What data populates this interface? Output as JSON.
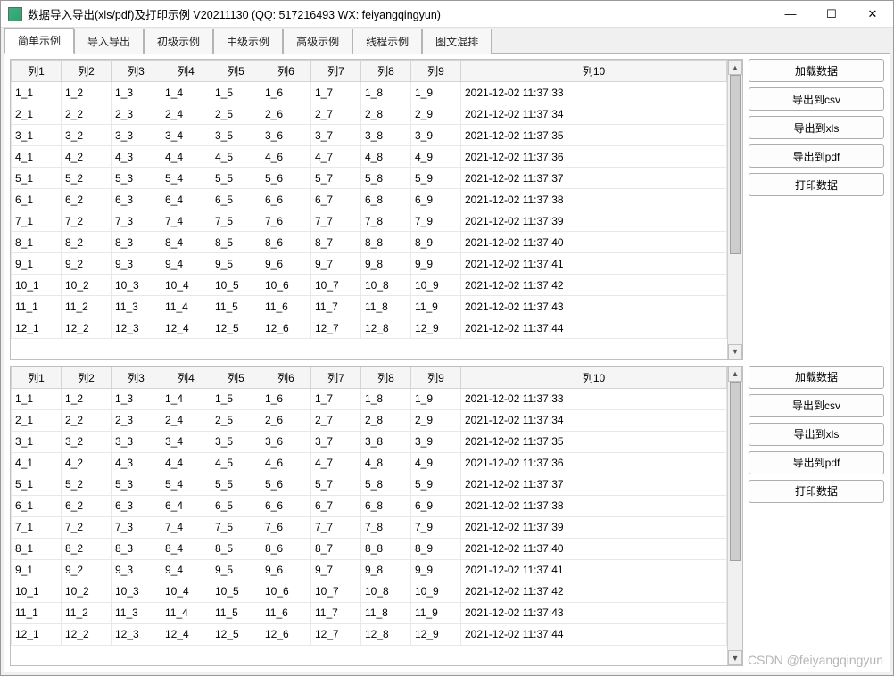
{
  "window": {
    "title": "数据导入导出(xls/pdf)及打印示例 V20211130 (QQ: 517216493 WX: feiyangqingyun)"
  },
  "tabs": [
    {
      "label": "简单示例",
      "active": true
    },
    {
      "label": "导入导出",
      "active": false
    },
    {
      "label": "初级示例",
      "active": false
    },
    {
      "label": "中级示例",
      "active": false
    },
    {
      "label": "高级示例",
      "active": false
    },
    {
      "label": "线程示例",
      "active": false
    },
    {
      "label": "图文混排",
      "active": false
    }
  ],
  "headers": [
    "列1",
    "列2",
    "列3",
    "列4",
    "列5",
    "列6",
    "列7",
    "列8",
    "列9",
    "列10"
  ],
  "rows": [
    [
      "1_1",
      "1_2",
      "1_3",
      "1_4",
      "1_5",
      "1_6",
      "1_7",
      "1_8",
      "1_9",
      "2021-12-02 11:37:33"
    ],
    [
      "2_1",
      "2_2",
      "2_3",
      "2_4",
      "2_5",
      "2_6",
      "2_7",
      "2_8",
      "2_9",
      "2021-12-02 11:37:34"
    ],
    [
      "3_1",
      "3_2",
      "3_3",
      "3_4",
      "3_5",
      "3_6",
      "3_7",
      "3_8",
      "3_9",
      "2021-12-02 11:37:35"
    ],
    [
      "4_1",
      "4_2",
      "4_3",
      "4_4",
      "4_5",
      "4_6",
      "4_7",
      "4_8",
      "4_9",
      "2021-12-02 11:37:36"
    ],
    [
      "5_1",
      "5_2",
      "5_3",
      "5_4",
      "5_5",
      "5_6",
      "5_7",
      "5_8",
      "5_9",
      "2021-12-02 11:37:37"
    ],
    [
      "6_1",
      "6_2",
      "6_3",
      "6_4",
      "6_5",
      "6_6",
      "6_7",
      "6_8",
      "6_9",
      "2021-12-02 11:37:38"
    ],
    [
      "7_1",
      "7_2",
      "7_3",
      "7_4",
      "7_5",
      "7_6",
      "7_7",
      "7_8",
      "7_9",
      "2021-12-02 11:37:39"
    ],
    [
      "8_1",
      "8_2",
      "8_3",
      "8_4",
      "8_5",
      "8_6",
      "8_7",
      "8_8",
      "8_9",
      "2021-12-02 11:37:40"
    ],
    [
      "9_1",
      "9_2",
      "9_3",
      "9_4",
      "9_5",
      "9_6",
      "9_7",
      "9_8",
      "9_9",
      "2021-12-02 11:37:41"
    ],
    [
      "10_1",
      "10_2",
      "10_3",
      "10_4",
      "10_5",
      "10_6",
      "10_7",
      "10_8",
      "10_9",
      "2021-12-02 11:37:42"
    ],
    [
      "11_1",
      "11_2",
      "11_3",
      "11_4",
      "11_5",
      "11_6",
      "11_7",
      "11_8",
      "11_9",
      "2021-12-02 11:37:43"
    ],
    [
      "12_1",
      "12_2",
      "12_3",
      "12_4",
      "12_5",
      "12_6",
      "12_7",
      "12_8",
      "12_9",
      "2021-12-02 11:37:44"
    ]
  ],
  "buttons": {
    "load": "加载数据",
    "csv": "导出到csv",
    "xls": "导出到xls",
    "pdf": "导出到pdf",
    "print": "打印数据"
  },
  "watermark": "CSDN @feiyangqingyun"
}
